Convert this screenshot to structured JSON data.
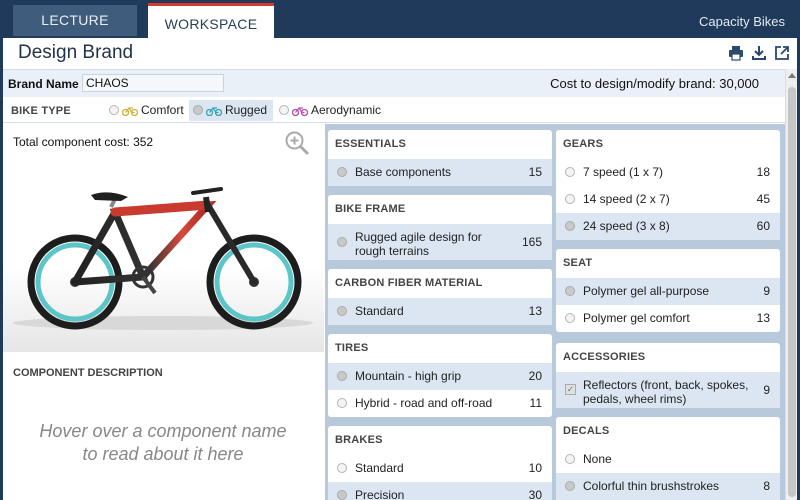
{
  "tabs": [
    {
      "label": "LECTURE"
    },
    {
      "label": "WORKSPACE"
    }
  ],
  "company": "Capacity Bikes",
  "page": {
    "title": "Design Brand",
    "toolbar_icons": [
      "print-icon",
      "download-icon",
      "popout-icon"
    ]
  },
  "brand": {
    "label": "Brand Name",
    "value": "CHAOS",
    "cost_text": "Cost to design/modify brand: 30,000"
  },
  "bike_type": {
    "label": "BIKE TYPE",
    "options": [
      {
        "label": "Comfort",
        "selected": false,
        "color": "#c9b33a"
      },
      {
        "label": "Rugged",
        "selected": true,
        "color": "#3aa1b0"
      },
      {
        "label": "Aerodynamic",
        "selected": false,
        "color": "#b74ea8"
      }
    ]
  },
  "left": {
    "total_cost": "Total component cost: 352",
    "component_desc_label": "COMPONENT DESCRIPTION",
    "hover_text": "Hover over a component name to read about it here"
  },
  "sections": {
    "essentials": {
      "title": "ESSENTIALS",
      "items": [
        {
          "label": "Base components",
          "price": "15",
          "selected": true
        }
      ]
    },
    "frame": {
      "title": "BIKE FRAME",
      "items": [
        {
          "label": "Rugged agile design for rough terrains",
          "price": "165",
          "selected": true
        }
      ]
    },
    "carbon": {
      "title": "CARBON FIBER MATERIAL",
      "items": [
        {
          "label": "Standard",
          "price": "13",
          "selected": true
        }
      ]
    },
    "tires": {
      "title": "TIRES",
      "items": [
        {
          "label": "Mountain - high grip",
          "price": "20",
          "selected": true
        },
        {
          "label": "Hybrid - road and off-road",
          "price": "11",
          "selected": false
        }
      ]
    },
    "brakes": {
      "title": "BRAKES",
      "items": [
        {
          "label": "Standard",
          "price": "10",
          "selected": false
        },
        {
          "label": "Precision",
          "price": "30",
          "selected": true
        }
      ]
    },
    "gears": {
      "title": "GEARS",
      "items": [
        {
          "label": "7 speed (1 x 7)",
          "price": "18",
          "selected": false
        },
        {
          "label": "14 speed (2 x 7)",
          "price": "45",
          "selected": false
        },
        {
          "label": "24 speed (3 x 8)",
          "price": "60",
          "selected": true
        }
      ]
    },
    "seat": {
      "title": "SEAT",
      "items": [
        {
          "label": "Polymer gel all-purpose",
          "price": "9",
          "selected": true
        },
        {
          "label": "Polymer gel comfort",
          "price": "13",
          "selected": false
        }
      ]
    },
    "accessories": {
      "title": "ACCESSORIES",
      "items": [
        {
          "label": "Reflectors (front, back, spokes, pedals, wheel rims)",
          "price": "9",
          "selected": true
        }
      ]
    },
    "decals": {
      "title": "DECALS",
      "items": [
        {
          "label": "None",
          "price": "",
          "selected": false
        },
        {
          "label": "Colorful thin brushstrokes",
          "price": "8",
          "selected": true
        }
      ]
    }
  }
}
